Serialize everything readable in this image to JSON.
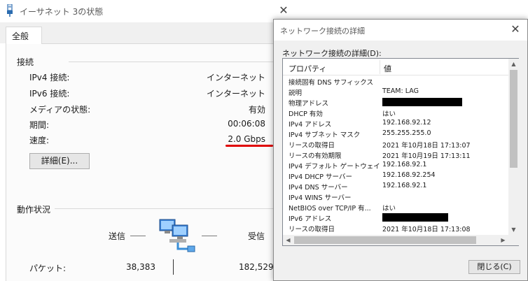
{
  "status_window": {
    "title": "イーサネット 3の状態",
    "tab_label": "全般",
    "connection_group_title": "接続",
    "rows": [
      {
        "label": "IPv4 接続:",
        "value": "インターネット"
      },
      {
        "label": "IPv6 接続:",
        "value": "インターネット"
      },
      {
        "label": "メディアの状態:",
        "value": "有効"
      },
      {
        "label": "期間:",
        "value": "00:06:08"
      },
      {
        "label": "速度:",
        "value": "2.0 Gbps"
      }
    ],
    "details_button_label": "詳細(E)...",
    "activity_group_title": "動作状況",
    "sent_label": "送信",
    "received_label": "受信",
    "packets_label": "パケット:",
    "packets_sent": "38,383",
    "packets_received": "182,529",
    "close_symbol": "✕",
    "highlight_color": "#e00000"
  },
  "details_window": {
    "title": "ネットワーク接続の詳細",
    "list_caption": "ネットワーク接続の詳細(D):",
    "col_property": "プロパティ",
    "col_value": "値",
    "rows": [
      {
        "prop": "接続固有 DNS サフィックス",
        "value": ""
      },
      {
        "prop": "説明",
        "value": "TEAM: LAG"
      },
      {
        "prop": "物理アドレス",
        "value": "",
        "redacted": true
      },
      {
        "prop": "DHCP 有効",
        "value": "はい"
      },
      {
        "prop": "IPv4 アドレス",
        "value": "192.168.92.12"
      },
      {
        "prop": "IPv4 サブネット マスク",
        "value": "255.255.255.0"
      },
      {
        "prop": "リースの取得日",
        "value": "2021 年10月18日 17:13:07"
      },
      {
        "prop": "リースの有効期限",
        "value": "2021 年10月19日 17:13:11"
      },
      {
        "prop": "IPv4 デフォルト ゲートウェイ",
        "value": "192.168.92.1"
      },
      {
        "prop": "IPv4 DHCP サーバー",
        "value": "192.168.92.254"
      },
      {
        "prop": "IPv4 DNS サーバー",
        "value": "192.168.92.1"
      },
      {
        "prop": "IPv4 WINS サーバー",
        "value": ""
      },
      {
        "prop": "NetBIOS over TCP/IP 有...",
        "value": "はい"
      },
      {
        "prop": "IPv6 アドレス",
        "value": "",
        "redacted": true
      },
      {
        "prop": "リースの取得日",
        "value": "2021 年10月18日 17:13:08"
      }
    ],
    "close_button_label": "閉じる(C)",
    "close_symbol": "✕"
  }
}
